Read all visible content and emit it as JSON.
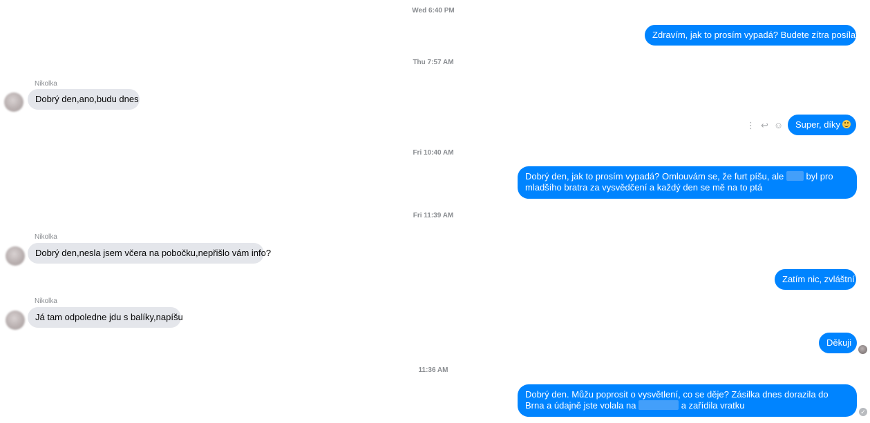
{
  "conversation": {
    "timestamps": [
      "Wed 6:40 PM",
      "Thu 7:57 AM",
      "Fri 10:40 AM",
      "Fri 11:39 AM",
      "11:36 AM"
    ],
    "sender_name": "Nikolka",
    "messages": {
      "m1": "Zdravím, jak to prosím vypadá? Budete zítra posílat?",
      "m2": "Dobrý den,ano,budu dnes",
      "m3": "Super, díky",
      "m4_a": "Dobrý den, jak to prosím vypadá? Omlouvám se, že furt píšu, ale",
      "m4_b": "byl pro mladšího bratra za vysvědčení a každý den se mě na to ptá",
      "m5": "Dobrý den,nesla jsem včera na pobočku,nepřišlo vám info?",
      "m6": "Zatím nic, zvláštní",
      "m7": "Já tam odpoledne jdu s balíky,napíšu",
      "m8": "Děkuji",
      "m9_a": "Dobrý den. Můžu poprosit o vysvětlení, co se děje? Zásilka dnes dorazila do Brna a údajně jste volala na",
      "m9_b": "a zařídila vratku"
    },
    "icons": {
      "more": "more-vertical-icon",
      "reply": "reply-icon",
      "react": "emoji-reaction-icon",
      "emoji_in_message": "smiling-emoji-icon",
      "seen": "seen-avatar-icon",
      "delivered": "delivered-check-icon"
    },
    "colors": {
      "outgoing_bubble": "#0084ff",
      "incoming_bubble": "#e4e6eb",
      "timestamp_text": "#8a8d91"
    }
  }
}
